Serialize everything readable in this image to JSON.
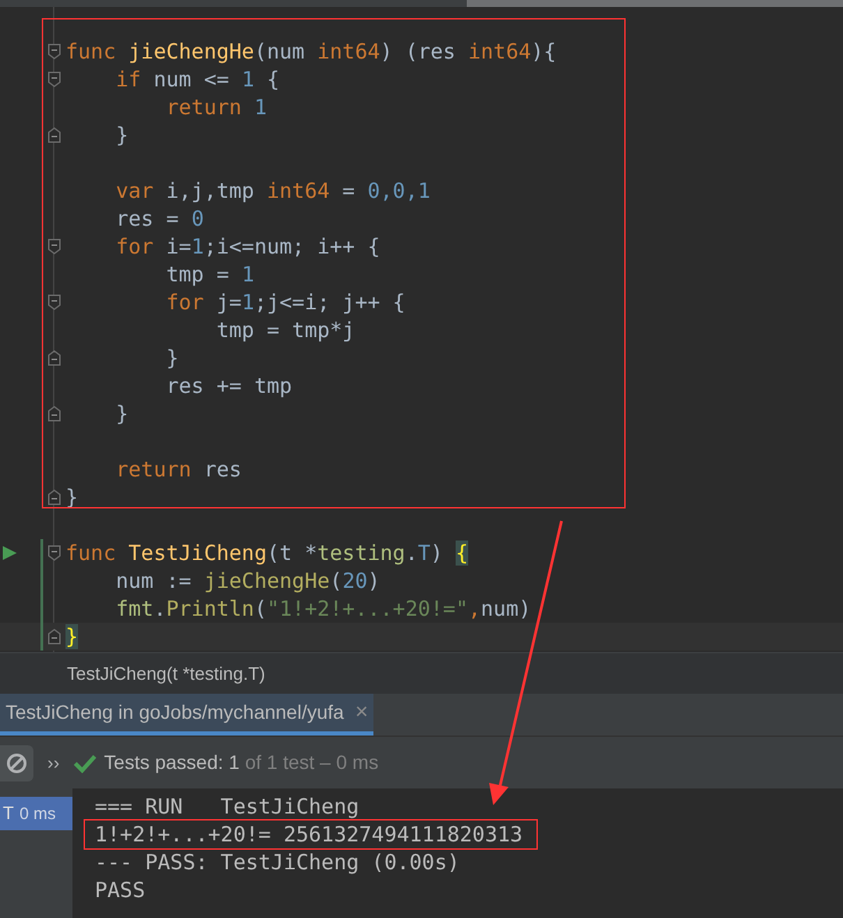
{
  "editor": {
    "lines": [
      {
        "kind": "code",
        "fold_open": true,
        "tokens": [
          {
            "t": "func ",
            "kind": "kw"
          },
          {
            "t": "jieChengHe",
            "kind": "fn"
          },
          {
            "t": "(num ",
            "kind": "plain"
          },
          {
            "t": "int64",
            "kind": "kw"
          },
          {
            "t": ") (res ",
            "kind": "plain"
          },
          {
            "t": "int64",
            "kind": "kw"
          },
          {
            "t": "){",
            "kind": "plain"
          }
        ]
      },
      {
        "kind": "code",
        "fold_open": true,
        "tokens": [
          {
            "t": "    if ",
            "kind": "kw"
          },
          {
            "t": "num <= ",
            "kind": "plain"
          },
          {
            "t": "1",
            "kind": "num"
          },
          {
            "t": " {",
            "kind": "plain"
          }
        ]
      },
      {
        "kind": "code",
        "tokens": [
          {
            "t": "        return ",
            "kind": "kw"
          },
          {
            "t": "1",
            "kind": "num"
          }
        ]
      },
      {
        "kind": "code",
        "fold_close": true,
        "tokens": [
          {
            "t": "    }",
            "kind": "plain"
          }
        ]
      },
      {
        "kind": "blank"
      },
      {
        "kind": "code",
        "tokens": [
          {
            "t": "    var ",
            "kind": "kw"
          },
          {
            "t": "i,j,tmp ",
            "kind": "plain"
          },
          {
            "t": "int64",
            "kind": "kw"
          },
          {
            "t": " = ",
            "kind": "plain"
          },
          {
            "t": "0,0,1",
            "kind": "num"
          }
        ]
      },
      {
        "kind": "code",
        "tokens": [
          {
            "t": "    res = ",
            "kind": "plain"
          },
          {
            "t": "0",
            "kind": "num"
          }
        ]
      },
      {
        "kind": "code",
        "fold_open": true,
        "tokens": [
          {
            "t": "    for ",
            "kind": "kw"
          },
          {
            "t": "i=",
            "kind": "plain"
          },
          {
            "t": "1",
            "kind": "num"
          },
          {
            "t": ";i<=num; i++ {",
            "kind": "plain"
          }
        ]
      },
      {
        "kind": "code",
        "tokens": [
          {
            "t": "        tmp = ",
            "kind": "plain"
          },
          {
            "t": "1",
            "kind": "num"
          }
        ]
      },
      {
        "kind": "code",
        "fold_open": true,
        "tokens": [
          {
            "t": "        for ",
            "kind": "kw"
          },
          {
            "t": "j=",
            "kind": "plain"
          },
          {
            "t": "1",
            "kind": "num"
          },
          {
            "t": ";j<=i; j++ {",
            "kind": "plain"
          }
        ]
      },
      {
        "kind": "code",
        "tokens": [
          {
            "t": "            tmp = tmp*j",
            "kind": "plain"
          }
        ]
      },
      {
        "kind": "code",
        "fold_close": true,
        "tokens": [
          {
            "t": "        }",
            "kind": "plain"
          }
        ]
      },
      {
        "kind": "code",
        "tokens": [
          {
            "t": "        res += tmp",
            "kind": "plain"
          }
        ]
      },
      {
        "kind": "code",
        "fold_close": true,
        "tokens": [
          {
            "t": "    }",
            "kind": "plain"
          }
        ]
      },
      {
        "kind": "blank"
      },
      {
        "kind": "code",
        "tokens": [
          {
            "t": "    return ",
            "kind": "kw"
          },
          {
            "t": "res",
            "kind": "plain"
          }
        ]
      },
      {
        "kind": "code",
        "fold_close": true,
        "tokens": [
          {
            "t": "}",
            "kind": "plain"
          }
        ]
      },
      {
        "kind": "blank"
      },
      {
        "kind": "code",
        "fold_open": true,
        "run": true,
        "changed": true,
        "tokens": [
          {
            "t": "func ",
            "kind": "kw"
          },
          {
            "t": "TestJiCheng",
            "kind": "fn"
          },
          {
            "t": "(t *",
            "kind": "plain"
          },
          {
            "t": "testing",
            "kind": "pkg"
          },
          {
            "t": ".",
            "kind": "plain"
          },
          {
            "t": "T",
            "kind": "num"
          },
          {
            "t": ") ",
            "kind": "plain"
          },
          {
            "t": "{",
            "kind": "brace"
          }
        ]
      },
      {
        "kind": "code",
        "changed": true,
        "tokens": [
          {
            "t": "    num := ",
            "kind": "plain"
          },
          {
            "t": "jieChengHe",
            "kind": "call"
          },
          {
            "t": "(",
            "kind": "plain"
          },
          {
            "t": "20",
            "kind": "num"
          },
          {
            "t": ")",
            "kind": "plain"
          }
        ]
      },
      {
        "kind": "code",
        "changed": true,
        "tokens": [
          {
            "t": "    fmt",
            "kind": "pkg"
          },
          {
            "t": ".",
            "kind": "plain"
          },
          {
            "t": "Println",
            "kind": "call"
          },
          {
            "t": "(",
            "kind": "plain"
          },
          {
            "t": "\"1!+2!+...+20!=\"",
            "kind": "str"
          },
          {
            "t": ",",
            "kind": "kw"
          },
          {
            "t": "num)",
            "kind": "plain"
          }
        ]
      },
      {
        "kind": "code",
        "fold_close": true,
        "changed": true,
        "current": true,
        "tokens": [
          {
            "t": "}",
            "kind": "brace"
          }
        ]
      }
    ]
  },
  "breadcrumb": "TestJiCheng(t *testing.T)",
  "run_tab": {
    "label": "TestJiCheng in goJobs/mychannel/yufa",
    "close": "×",
    "selected": true
  },
  "toolbar": {
    "expand": "››",
    "status_label": "Tests passed: ",
    "passed": "1",
    "detail": " of 1 test – 0 ms"
  },
  "test_tree": [
    {
      "name": "T",
      "time": "0 ms",
      "selected": true
    }
  ],
  "console": [
    {
      "text": "=== RUN   TestJiCheng"
    },
    {
      "text": "1!+2!+...+20!= 2561327494111820313",
      "annotated": true
    },
    {
      "text": "--- PASS: TestJiCheng (0.00s)"
    },
    {
      "text": "PASS"
    }
  ]
}
